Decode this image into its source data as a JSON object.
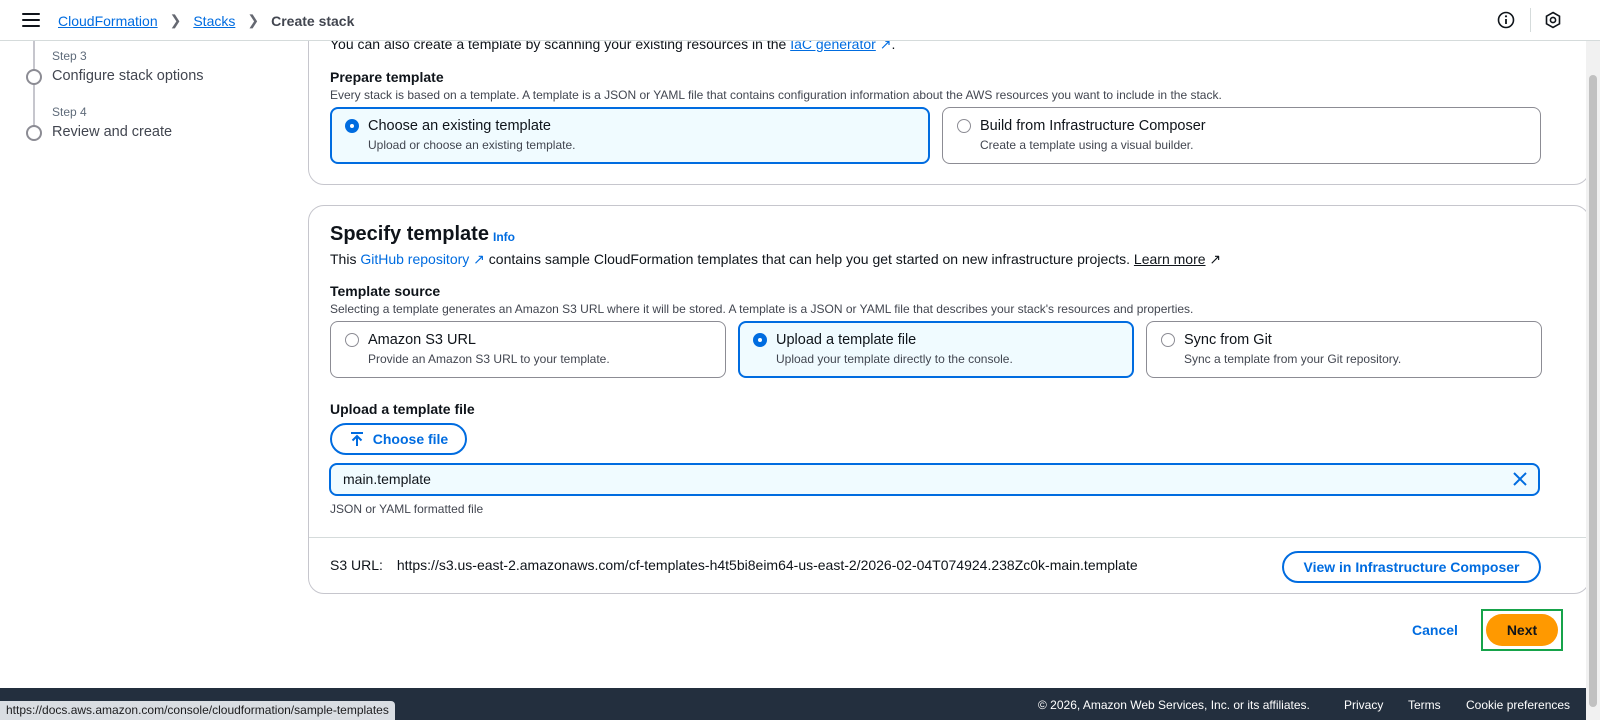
{
  "breadcrumbs": {
    "item1": "CloudFormation",
    "item2": "Stacks",
    "current": "Create stack"
  },
  "steps": [
    {
      "num": "Step 3",
      "title": "Configure stack options"
    },
    {
      "num": "Step 4",
      "title": "Review and create"
    }
  ],
  "prepare": {
    "intro_text": "You can also create a template by scanning your existing resources in the",
    "intro_link": "IaC generator",
    "label": "Prepare template",
    "desc": "Every stack is based on a template. A template is a JSON or YAML file that contains configuration information about the AWS resources you want to include in the stack.",
    "options": [
      {
        "title": "Choose an existing template",
        "desc": "Upload or choose an existing template."
      },
      {
        "title": "Build from Infrastructure Composer",
        "desc": "Create a template using a visual builder."
      }
    ]
  },
  "specify": {
    "heading": "Specify template",
    "info": "Info",
    "desc_pre": "This",
    "desc_link": "GitHub repository",
    "desc_mid": "contains sample CloudFormation templates that can help you get started on new infrastructure projects.",
    "learn_more": "Learn more",
    "source_label": "Template source",
    "source_desc": "Selecting a template generates an Amazon S3 URL where it will be stored. A template is a JSON or YAML file that describes your stack's resources and properties.",
    "sources": [
      {
        "title": "Amazon S3 URL",
        "desc": "Provide an Amazon S3 URL to your template."
      },
      {
        "title": "Upload a template file",
        "desc": "Upload your template directly to the console."
      },
      {
        "title": "Sync from Git",
        "desc": "Sync a template from your Git repository."
      }
    ],
    "upload_label": "Upload a template file",
    "choose_file": "Choose file",
    "file_name": "main.template",
    "file_hint": "JSON or YAML formatted file",
    "s3_label": "S3 URL:",
    "s3_url": "https://s3.us-east-2.amazonaws.com/cf-templates-h4t5bi8eim64-us-east-2/2026-02-04T074924.238Zc0k-main.template",
    "view_composer": "View in Infrastructure Composer"
  },
  "actions": {
    "cancel": "Cancel",
    "next": "Next"
  },
  "footer": {
    "copyright": "© 2026, Amazon Web Services, Inc. or its affiliates.",
    "privacy": "Privacy",
    "terms": "Terms",
    "cookies": "Cookie preferences"
  },
  "status_url": "https://docs.aws.amazon.com/console/cloudformation/sample-templates",
  "colors": {
    "primary": "#006ce0",
    "next_button": "#ff9900",
    "footer": "#232f3e"
  }
}
